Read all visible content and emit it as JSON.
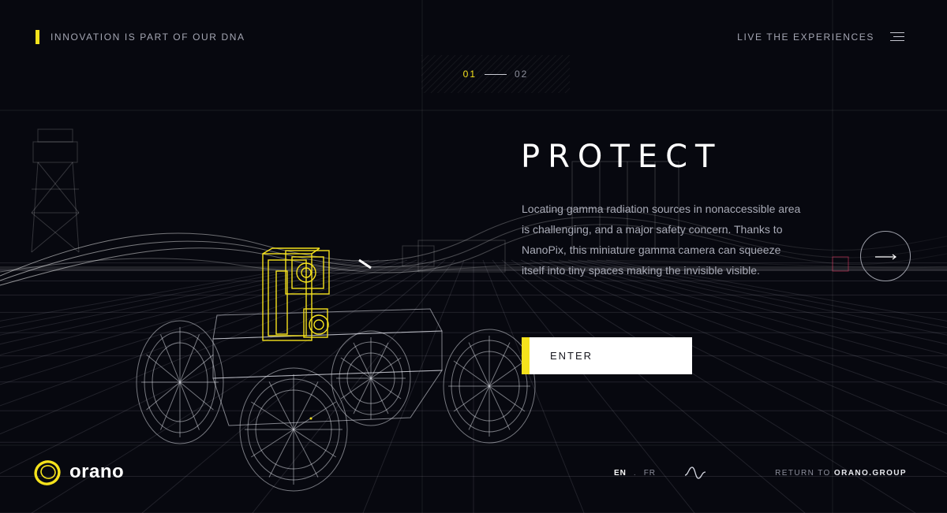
{
  "header": {
    "tagline": "INNOVATION IS PART OF OUR DNA",
    "experiences_label": "LIVE THE EXPERIENCES",
    "menu_icon": "hamburger-menu-icon"
  },
  "pager": {
    "current": "01",
    "next": "02"
  },
  "hero": {
    "title": "PROTECT",
    "description": "Locating gamma radiation sources in nonaccessible area is challenging, and a major safety concern. Thanks to NanoPix, this miniature gamma camera can squeeze itself into tiny spaces making the invisible visible.",
    "enter_label": "ENTER",
    "next_icon": "arrow-right-icon"
  },
  "footer": {
    "brand": "orano",
    "lang_en": "EN",
    "lang_sep": ".",
    "lang_fr": "FR",
    "sound_icon": "sound-wave-icon",
    "return_prefix": "RETURN TO",
    "return_link": "ORANO.GROUP"
  },
  "colors": {
    "background": "#07080f",
    "accent": "#f5e21c",
    "text_muted": "#a4a6b3",
    "wireframe": "#d6d8e2"
  }
}
